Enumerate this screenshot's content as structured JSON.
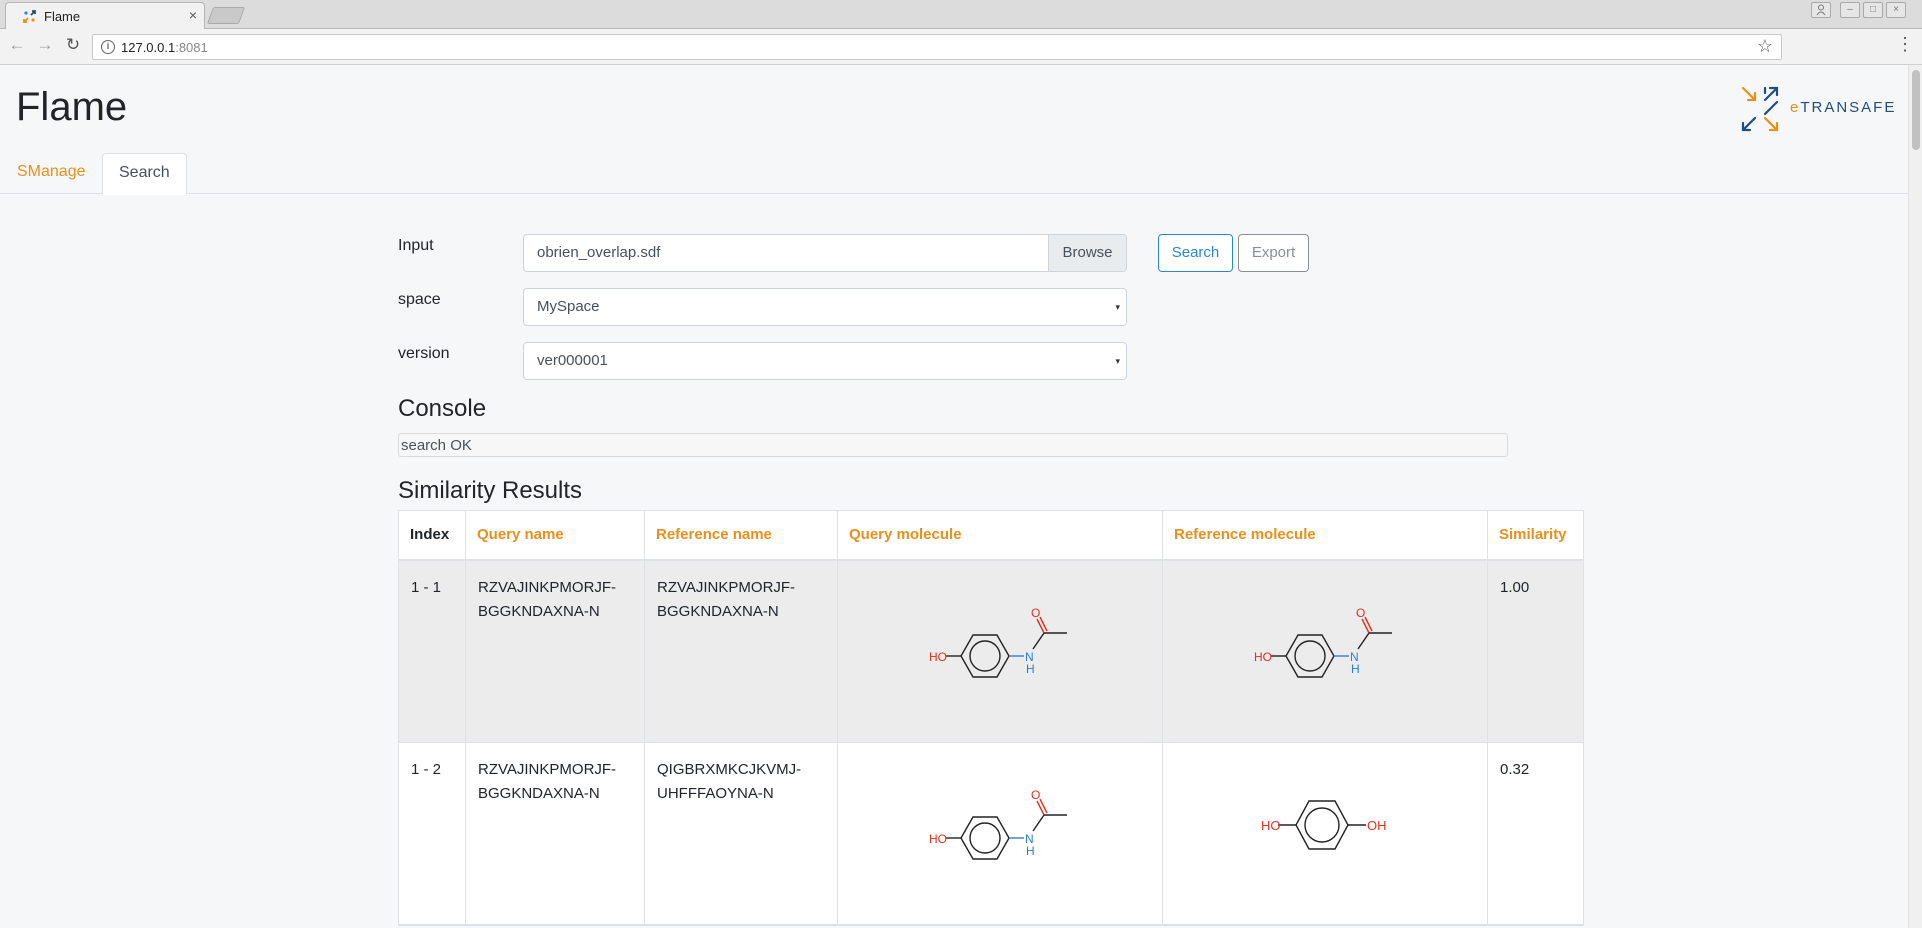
{
  "browser": {
    "tab_title": "Flame",
    "tab_close": "×",
    "url_host": "127.0.0.1",
    "url_port": ":8081",
    "back_glyph": "←",
    "forward_glyph": "→",
    "reload_glyph": "↻",
    "info_glyph": "i",
    "star_glyph": "☆",
    "menu_glyph": "⋮",
    "win_user": "👤",
    "win_min": "–",
    "win_max": "□",
    "win_close": "×"
  },
  "header": {
    "app_title": "Flame",
    "logo_text_e": "e",
    "logo_text_rest": "TRANSAFE"
  },
  "nav": {
    "tabs": [
      {
        "label": "SManage",
        "active": false
      },
      {
        "label": "Search",
        "active": true
      }
    ]
  },
  "form": {
    "input_label": "Input",
    "file_name": "obrien_overlap.sdf",
    "browse_label": "Browse",
    "search_label": "Search",
    "export_label": "Export",
    "space_label": "space",
    "space_value": "MySpace",
    "version_label": "version",
    "version_value": "ver000001",
    "caret": "▾"
  },
  "console": {
    "heading": "Console",
    "text": "search OK"
  },
  "results": {
    "heading": "Similarity Results",
    "columns": [
      "Index",
      "Query name",
      "Reference name",
      "Query molecule",
      "Reference molecule",
      "Similarity"
    ],
    "rows": [
      {
        "index": "1 - 1",
        "query_name": "RZVAJINKPMORJF-BGGKNDAXNA-N",
        "reference_name": "RZVAJINKPMORJF-BGGKNDAXNA-N",
        "query_molecule": "paracetamol",
        "reference_molecule": "paracetamol",
        "similarity": "1.00"
      },
      {
        "index": "1 - 2",
        "query_name": "RZVAJINKPMORJF-BGGKNDAXNA-N",
        "reference_name": "QIGBRXMKCJKVMJ-UHFFFAOYNA-N",
        "query_molecule": "paracetamol",
        "reference_molecule": "hydroquinone",
        "similarity": "0.32"
      }
    ]
  },
  "atoms": {
    "ho": "HO",
    "oh": "OH",
    "o": "O",
    "n": "N",
    "h": "H"
  },
  "colors": {
    "accent": "#e8901b",
    "primary": "#2a85d8",
    "oxygen": "#e0301e",
    "nitrogen": "#2a7fd4"
  }
}
